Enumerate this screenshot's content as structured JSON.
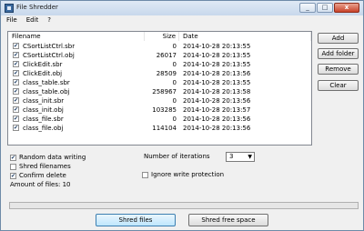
{
  "window": {
    "title": "File Shredder",
    "icon": "app-icon",
    "controls": [
      "_",
      "□",
      "x"
    ]
  },
  "menu": [
    "File",
    "Edit",
    "?"
  ],
  "list": {
    "headers": {
      "name": "Filename",
      "size": "Size",
      "date": "Date"
    },
    "rows": [
      {
        "checked": true,
        "name": "CSortListCtrl.sbr",
        "size": "0",
        "date": "2014-10-28 20:13:55"
      },
      {
        "checked": true,
        "name": "CSortListCtrl.obj",
        "size": "26017",
        "date": "2014-10-28 20:13:55"
      },
      {
        "checked": true,
        "name": "ClickEdit.sbr",
        "size": "0",
        "date": "2014-10-28 20:13:55"
      },
      {
        "checked": true,
        "name": "ClickEdit.obj",
        "size": "28509",
        "date": "2014-10-28 20:13:56"
      },
      {
        "checked": true,
        "name": "class_table.sbr",
        "size": "0",
        "date": "2014-10-28 20:13:55"
      },
      {
        "checked": true,
        "name": "class_table.obj",
        "size": "258967",
        "date": "2014-10-28 20:13:58"
      },
      {
        "checked": true,
        "name": "class_init.sbr",
        "size": "0",
        "date": "2014-10-28 20:13:56"
      },
      {
        "checked": true,
        "name": "class_init.obj",
        "size": "103285",
        "date": "2014-10-28 20:13:57"
      },
      {
        "checked": true,
        "name": "class_file.sbr",
        "size": "0",
        "date": "2014-10-28 20:13:56"
      },
      {
        "checked": true,
        "name": "class_file.obj",
        "size": "114104",
        "date": "2014-10-28 20:13:56"
      }
    ]
  },
  "buttons": {
    "add": "Add",
    "add_folder": "Add folder",
    "remove": "Remove",
    "clear": "Clear"
  },
  "options": {
    "random_data": {
      "label": "Random data writing",
      "checked": true
    },
    "shred_filenames": {
      "label": "Shred filenames",
      "checked": false
    },
    "confirm_delete": {
      "label": "Confirm delete",
      "checked": true
    },
    "amount": "Amount of files: 10",
    "iterations_label": "Number of iterations",
    "iterations_value": "3",
    "ignore_protection": {
      "label": "Ignore write protection",
      "checked": false
    }
  },
  "progress": {
    "fraction": 0
  },
  "actions": {
    "shred_files": "Shred files",
    "shred_free_space": "Shred free space"
  },
  "colors": {
    "progress_fill": "#5aa84b",
    "title_bar": "#c8d8ec"
  }
}
